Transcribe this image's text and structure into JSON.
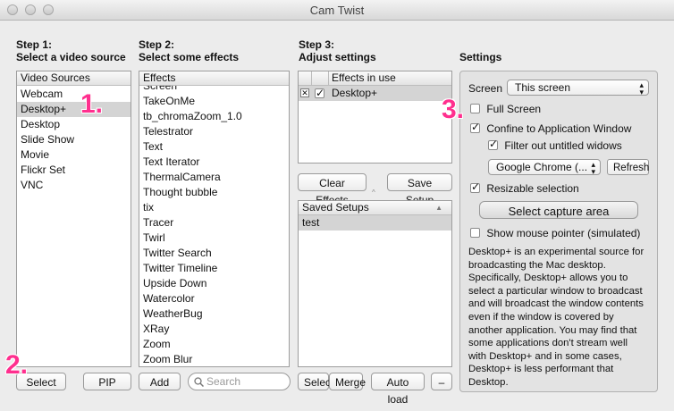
{
  "window": {
    "title": "Cam Twist"
  },
  "steps": {
    "step1": {
      "line1": "Step 1:",
      "line2": "Select a video source"
    },
    "step2": {
      "line1": "Step 2:",
      "line2": "Select some effects"
    },
    "step3": {
      "line1": "Step 3:",
      "line2": "Adjust settings"
    },
    "settings": "Settings"
  },
  "video_sources": {
    "header": "Video Sources",
    "items": [
      "Webcam",
      "Desktop+",
      "Desktop",
      "Slide Show",
      "Movie",
      "Flickr Set",
      "VNC"
    ],
    "selected_index": 1
  },
  "effects": {
    "header": "Effects",
    "partial_top": "Screen",
    "items": [
      "TakeOnMe",
      "tb_chromaZoom_1.0",
      "Telestrator",
      "Text",
      "Text Iterator",
      "ThermalCamera",
      "Thought bubble",
      "tix",
      "Tracer",
      "Twirl",
      "Twitter Search",
      "Twitter Timeline",
      "Upside Down",
      "Watercolor",
      "WeatherBug",
      "XRay",
      "Zoom",
      "Zoom Blur"
    ]
  },
  "effects_in_use": {
    "header": "Effects in use",
    "items": [
      {
        "label": "Desktop+",
        "enabled": true
      }
    ]
  },
  "saved_setups": {
    "header": "Saved Setups",
    "items": [
      "test"
    ]
  },
  "buttons": {
    "select": "Select",
    "pip": "PIP",
    "add": "Add",
    "clear_effects": "Clear Effects",
    "save_setup": "Save Setup",
    "select2": "Select",
    "merge": "Merge",
    "auto_load": "Auto load",
    "remove": "–",
    "refresh": "Refresh",
    "select_capture_area": "Select capture area"
  },
  "search": {
    "placeholder": "Search"
  },
  "settings": {
    "screen_label": "Screen",
    "screen_value": "This screen",
    "full_screen": {
      "label": "Full Screen",
      "checked": false
    },
    "confine": {
      "label": "Confine to Application Window",
      "checked": true
    },
    "filter_untitled": {
      "label": "Filter out untitled widows",
      "checked": true
    },
    "app_value": "Google Chrome (...",
    "resizable": {
      "label": "Resizable selection",
      "checked": true
    },
    "show_pointer": {
      "label": "Show mouse pointer (simulated)",
      "checked": false
    },
    "description": "Desktop+ is an experimental source for broadcasting the Mac desktop. Specifically, Desktop+ allows you to select a particular window to broadcast and will broadcast the window contents even if the window is covered by another application. You may find that some applications don't stream well with Desktop+ and in some cases, Desktop+ is less performant that Desktop."
  },
  "annotations": {
    "one": "1.",
    "two": "2.",
    "three": "3."
  },
  "colors": {
    "annotation": "#ff2f8e",
    "selection": "#d4d4d4"
  }
}
